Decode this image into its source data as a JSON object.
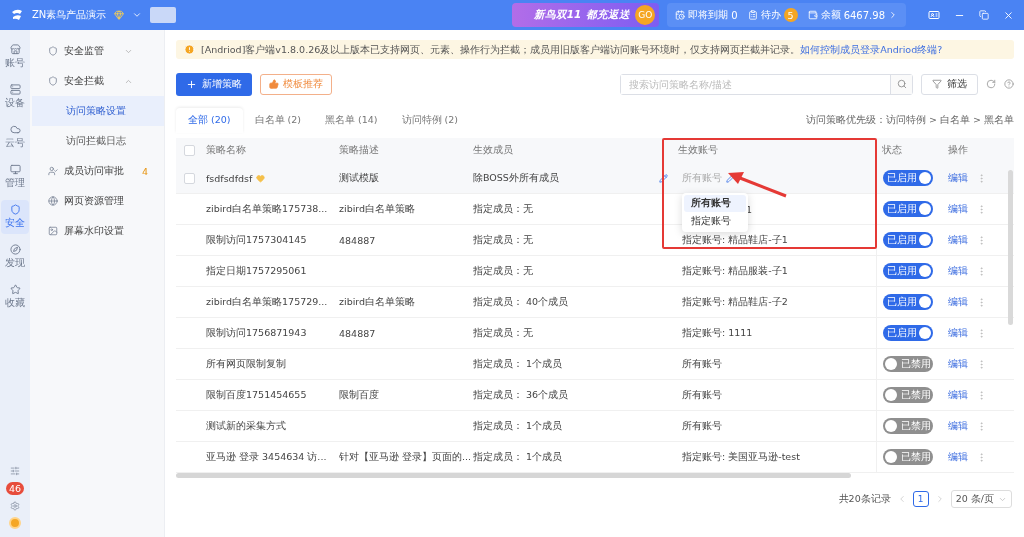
{
  "titlebar": {
    "workspace": "ZN素鸟产品演示",
    "promo": {
      "title": "新鸟双11",
      "slogan": "都充返送",
      "go": "GO"
    },
    "stats": [
      {
        "kind": "expiry",
        "label": "即将到期",
        "value": "0"
      },
      {
        "kind": "todo",
        "label": "待办",
        "value": "5"
      },
      {
        "kind": "balance",
        "label": "余额",
        "value": "6467.98"
      }
    ]
  },
  "rail": {
    "items": [
      {
        "label": "账号",
        "selected": false
      },
      {
        "label": "设备",
        "selected": false
      },
      {
        "label": "云号",
        "selected": false
      },
      {
        "label": "管理",
        "selected": false
      },
      {
        "label": "安全",
        "selected": true
      },
      {
        "label": "发现",
        "selected": false
      },
      {
        "label": "收藏",
        "selected": false
      }
    ],
    "badge": "46"
  },
  "sidebar": {
    "items": [
      {
        "label": "安全监管",
        "expanded": false
      },
      {
        "label": "安全拦截",
        "expanded": true,
        "children": [
          {
            "label": "访问策略设置",
            "selected": true
          },
          {
            "label": "访问拦截日志",
            "selected": false
          }
        ]
      },
      {
        "label": "成员访问审批",
        "badge": "4"
      },
      {
        "label": "网页资源管理"
      },
      {
        "label": "屏幕水印设置"
      }
    ]
  },
  "notice": {
    "text": "[Andriod]客户端v1.8.0.26及以上版本已支持网页、元素、操作行为拦截；成员用旧版客户端访问账号环境时，仅支持网页拦截并记录。",
    "link": "如何控制成员登录Andriod终端?"
  },
  "toolbar": {
    "add_button": "新增策略",
    "template_button": "模板推荐",
    "search": {
      "placeholder": "搜索访问策略名称/描述"
    },
    "filter_button": "筛选"
  },
  "tabs": [
    {
      "label": "全部 (20)",
      "selected": true
    },
    {
      "label": "白名单 (2)",
      "selected": false
    },
    {
      "label": "黑名单 (14)",
      "selected": false
    },
    {
      "label": "访问特例 (2)",
      "selected": false
    }
  ],
  "priority_note": "访问策略优先级：访问特例 > 白名单 > 黑名单",
  "table": {
    "select_all_checked": false,
    "columns": [
      "策略名称",
      "策略描述",
      "生效成员",
      "生效账号",
      "状态",
      "操作"
    ],
    "rows": [
      {
        "name": "fsdfsdfdsf",
        "flagged": true,
        "hovered": true,
        "checked": false,
        "description": "测试模版",
        "members": "除BOSS外所有成员",
        "account": "所有账号",
        "enabled": true,
        "status": "已启用",
        "action": "编辑"
      },
      {
        "name": "zibird白名单策略175738...",
        "hovered": false,
        "description": "zibird白名单策略",
        "members": "指定成员：无",
        "account": "1",
        "account_covered": true,
        "enabled": true,
        "status": "已启用",
        "action": "编辑"
      },
      {
        "name": "限制访问1757304145",
        "hovered": false,
        "description": "484887",
        "members": "指定成员：无",
        "account": "指定账号: 精品鞋店-子1",
        "enabled": true,
        "status": "已启用",
        "action": "编辑"
      },
      {
        "name": "指定日期1757295061",
        "hovered": false,
        "members": "指定成员：无",
        "account": "指定账号: 精品服装-子1",
        "enabled": true,
        "status": "已启用",
        "action": "编辑"
      },
      {
        "name": "zibird白名单策略175729...",
        "hovered": false,
        "description": "zibird白名单策略",
        "members": "指定成员： 40个成员",
        "account": "指定账号: 精品鞋店-子2",
        "enabled": true,
        "status": "已启用",
        "action": "编辑"
      },
      {
        "name": "限制访问1756871943",
        "hovered": false,
        "description": "484887",
        "members": "指定成员：无",
        "account": "指定账号: 1111",
        "enabled": true,
        "status": "已启用",
        "action": "编辑"
      },
      {
        "name": "所有网页限制复制",
        "hovered": false,
        "members": "指定成员： 1个成员",
        "account": "所有账号",
        "enabled": false,
        "status": "已禁用",
        "action": "编辑"
      },
      {
        "name": "限制百度1751454655",
        "hovered": false,
        "description": "限制百度",
        "members": "指定成员： 36个成员",
        "account": "所有账号",
        "enabled": false,
        "status": "已禁用",
        "action": "编辑"
      },
      {
        "name": "测试新的采集方式",
        "hovered": false,
        "members": "指定成员： 1个成员",
        "account": "所有账号",
        "enabled": false,
        "status": "已禁用",
        "action": "编辑"
      },
      {
        "name": "亚马逊 登录 3454634 访...",
        "hovered": false,
        "description": "针对【亚马逊 登录】页面的...",
        "members": "指定成员： 1个成员",
        "account": "指定账号: 美国亚马逊-test",
        "enabled": false,
        "status": "已禁用",
        "action": "编辑"
      }
    ],
    "account_menu": [
      {
        "label": "所有账号",
        "selected": true
      },
      {
        "label": "指定账号",
        "selected": false
      }
    ]
  },
  "pagination": {
    "total": "共20条记录",
    "pages": [
      {
        "label": "1",
        "selected": true
      }
    ],
    "page_size": "20 条/页"
  }
}
